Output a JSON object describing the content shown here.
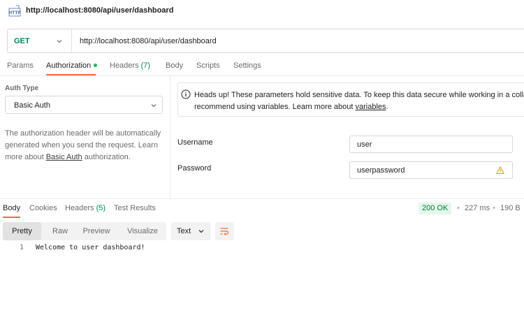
{
  "title": "http://localhost:8080/api/user/dashboard",
  "request": {
    "method": "GET",
    "url": "http://localhost:8080/api/user/dashboard"
  },
  "request_tabs": [
    {
      "label": "Params",
      "count": ""
    },
    {
      "label": "Authorization",
      "count": ""
    },
    {
      "label": "Headers",
      "count": "(7)"
    },
    {
      "label": "Body",
      "count": ""
    },
    {
      "label": "Scripts",
      "count": ""
    },
    {
      "label": "Settings",
      "count": ""
    }
  ],
  "auth": {
    "type_label": "Auth Type",
    "type_value": "Basic Auth",
    "desc_part1": "The authorization header will be automatically generated when you send the request. Learn more about ",
    "desc_link": "Basic Auth",
    "desc_part2": " authorization.",
    "headsup_line1": "Heads up! These parameters hold sensitive data. To keep this data secure while working in a collabo",
    "headsup_line2": "recommend using variables. Learn more about ",
    "headsup_link": "variables",
    "headsup_end": ".",
    "username_label": "Username",
    "username_value": "user",
    "password_label": "Password",
    "password_value": "userpassword"
  },
  "response_tabs": [
    {
      "label": "Body",
      "count": ""
    },
    {
      "label": "Cookies",
      "count": ""
    },
    {
      "label": "Headers",
      "count": "(5)"
    },
    {
      "label": "Test Results",
      "count": ""
    }
  ],
  "status": {
    "code": "200 OK",
    "time": "227 ms",
    "size": "190 B",
    "separator": "•"
  },
  "view_buttons": [
    "Pretty",
    "Raw",
    "Preview",
    "Visualize"
  ],
  "format": "Text",
  "response_lines": [
    {
      "num": "1",
      "text": "Welcome to user dashboard!"
    }
  ],
  "colors": {
    "accent": "#ff6c37",
    "method_get": "#00875a",
    "status_ok": "#007f31",
    "active_dot": "#0cbb52",
    "warning": "#e0a400"
  },
  "icons": {
    "title": "http-request-icon",
    "info": "info-icon",
    "warning": "warning-icon",
    "wrap": "wrap-lines-icon"
  }
}
